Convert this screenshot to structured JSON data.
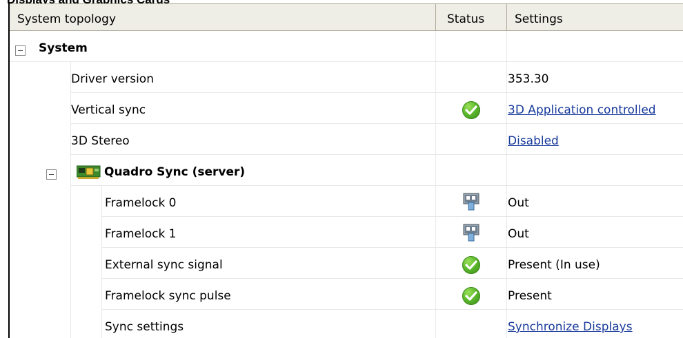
{
  "section_title": "Displays and Graphics Cards",
  "columns": {
    "topology": "System topology",
    "status": "Status",
    "settings": "Settings"
  },
  "rows": [
    {
      "label": "System",
      "status_icon": "",
      "setting": "",
      "setting_is_link": false,
      "level": 0,
      "expandable": true,
      "bold": true
    },
    {
      "label": "Driver version",
      "status_icon": "",
      "setting": "353.30",
      "setting_is_link": false,
      "level": 1
    },
    {
      "label": "Vertical sync",
      "status_icon": "check-icon",
      "setting": "3D Application controlled",
      "setting_is_link": true,
      "level": 1
    },
    {
      "label": "3D Stereo",
      "status_icon": "",
      "setting": "Disabled",
      "setting_is_link": true,
      "level": 1
    },
    {
      "label": "Quadro Sync (server)",
      "status_icon": "",
      "setting": "",
      "setting_is_link": false,
      "level": 1,
      "expandable": true,
      "bold": true,
      "item_icon": "sync-card-icon"
    },
    {
      "label": "Framelock 0",
      "status_icon": "framelock-connector-icon",
      "setting": "Out",
      "setting_is_link": false,
      "level": 2
    },
    {
      "label": "Framelock 1",
      "status_icon": "framelock-connector-icon",
      "setting": "Out",
      "setting_is_link": false,
      "level": 2
    },
    {
      "label": "External sync signal",
      "status_icon": "check-icon",
      "setting": "Present (In use)",
      "setting_is_link": false,
      "level": 2
    },
    {
      "label": "Framelock sync pulse",
      "status_icon": "check-icon",
      "setting": "Present",
      "setting_is_link": false,
      "level": 2
    },
    {
      "label": "Sync settings",
      "status_icon": "",
      "setting": "Synchronize Displays",
      "setting_is_link": true,
      "level": 2
    }
  ],
  "colors": {
    "link": "#1a3c9c",
    "header_bg": "#eeede6",
    "grid_line": "#e8e8e8",
    "status_ok": "#5bb82a"
  }
}
